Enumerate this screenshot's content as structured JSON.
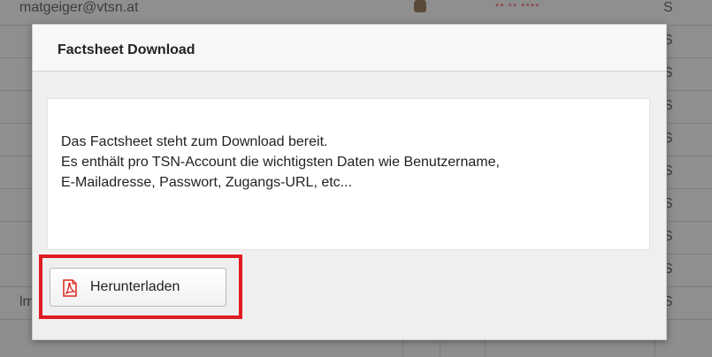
{
  "background": {
    "rows": [
      {
        "email": "matgeiger@vtsn.at",
        "password": "** ** ****",
        "flag": "S",
        "avatar": true
      },
      {
        "email": "",
        "password": "",
        "flag": "S",
        "avatar": false
      },
      {
        "email": "",
        "password": "",
        "flag": "S",
        "avatar": false
      },
      {
        "email": "",
        "password": "",
        "flag": "S",
        "avatar": false
      },
      {
        "email": "",
        "password": "",
        "flag": "S",
        "avatar": false
      },
      {
        "email": "",
        "password": "",
        "flag": "S",
        "avatar": false
      },
      {
        "email": "",
        "password": "",
        "flag": "S",
        "avatar": false
      },
      {
        "email": "",
        "password": "",
        "flag": "S",
        "avatar": false
      },
      {
        "email": "",
        "password": "",
        "flag": "S",
        "avatar": false
      },
      {
        "email": "lmusleeb@vtsn.at",
        "password": "** ** ****",
        "flag": "S",
        "avatar": true
      }
    ]
  },
  "dialog": {
    "title": "Factsheet Download",
    "lines": [
      "Das Factsheet steht zum Download bereit.",
      "Es enthält pro TSN-Account die wichtigsten Daten wie Benutzername,",
      "E-Mailadresse, Passwort, Zugangs-URL, etc..."
    ],
    "download_label": "Herunterladen",
    "download_icon": "pdf-icon"
  },
  "colors": {
    "highlight": "#e11b22",
    "pdf_icon": "#d9261c"
  }
}
